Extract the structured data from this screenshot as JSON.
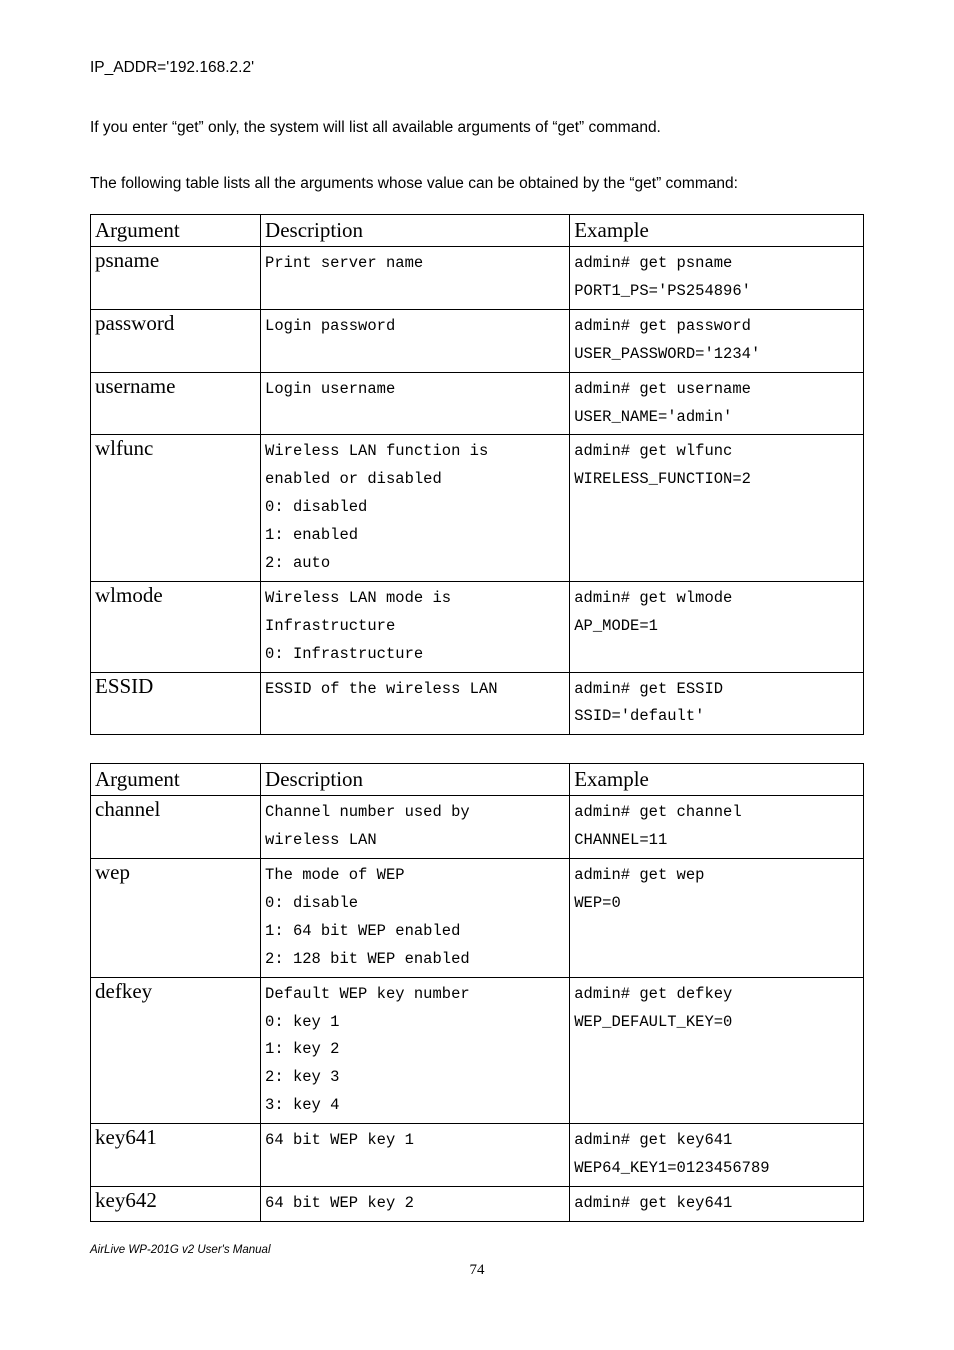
{
  "paragraphs": {
    "p1": "IP_ADDR='192.168.2.2'",
    "p2": "If you enter “get” only, the system will list all available arguments of “get” command.",
    "p3": "The following table lists all the arguments whose value can be obtained by the “get” command:"
  },
  "table1": {
    "headers": {
      "c1": "Argument",
      "c2": "Description",
      "c3": "Example"
    },
    "rows": [
      {
        "arg": "psname",
        "desc": "Print server name",
        "ex": "admin# get psname\nPORT1_PS='PS254896'"
      },
      {
        "arg": "password",
        "desc": "Login password",
        "ex": "admin# get password\nUSER_PASSWORD='1234'"
      },
      {
        "arg": "username",
        "desc": "Login username",
        "ex": "admin# get username\nUSER_NAME='admin'"
      },
      {
        "arg": "wlfunc",
        "desc": "Wireless LAN function is\nenabled or disabled\n0: disabled\n1: enabled\n2: auto",
        "ex": "admin# get wlfunc\nWIRELESS_FUNCTION=2"
      },
      {
        "arg": "wlmode",
        "desc": "Wireless LAN mode is\nInfrastructure\n0: Infrastructure",
        "ex": "admin# get wlmode\nAP_MODE=1"
      },
      {
        "arg": "ESSID",
        "desc": "ESSID of the wireless LAN",
        "ex": "admin# get ESSID\nSSID='default'"
      }
    ]
  },
  "table2": {
    "headers": {
      "c1": "Argument",
      "c2": "Description",
      "c3": "Example"
    },
    "rows": [
      {
        "arg": "channel",
        "desc": "Channel number used by\nwireless LAN",
        "ex": "admin# get channel\nCHANNEL=11"
      },
      {
        "arg": "wep",
        "desc": "The mode of WEP\n0: disable\n1: 64 bit WEP enabled\n2: 128 bit WEP enabled",
        "ex": "admin# get wep\nWEP=0"
      },
      {
        "arg": "defkey",
        "desc": "Default WEP key number\n0: key 1\n1: key 2\n2: key 3\n3: key 4",
        "ex": "admin# get defkey\nWEP_DEFAULT_KEY=0"
      },
      {
        "arg": "key641",
        "desc": "64 bit WEP key 1",
        "ex": "admin# get key641\nWEP64_KEY1=0123456789"
      },
      {
        "arg": "key642",
        "desc": "64 bit WEP key 2",
        "ex": "admin# get key641"
      }
    ]
  },
  "footer": "AirLive WP-201G v2 User's Manual",
  "pagenum": "74"
}
